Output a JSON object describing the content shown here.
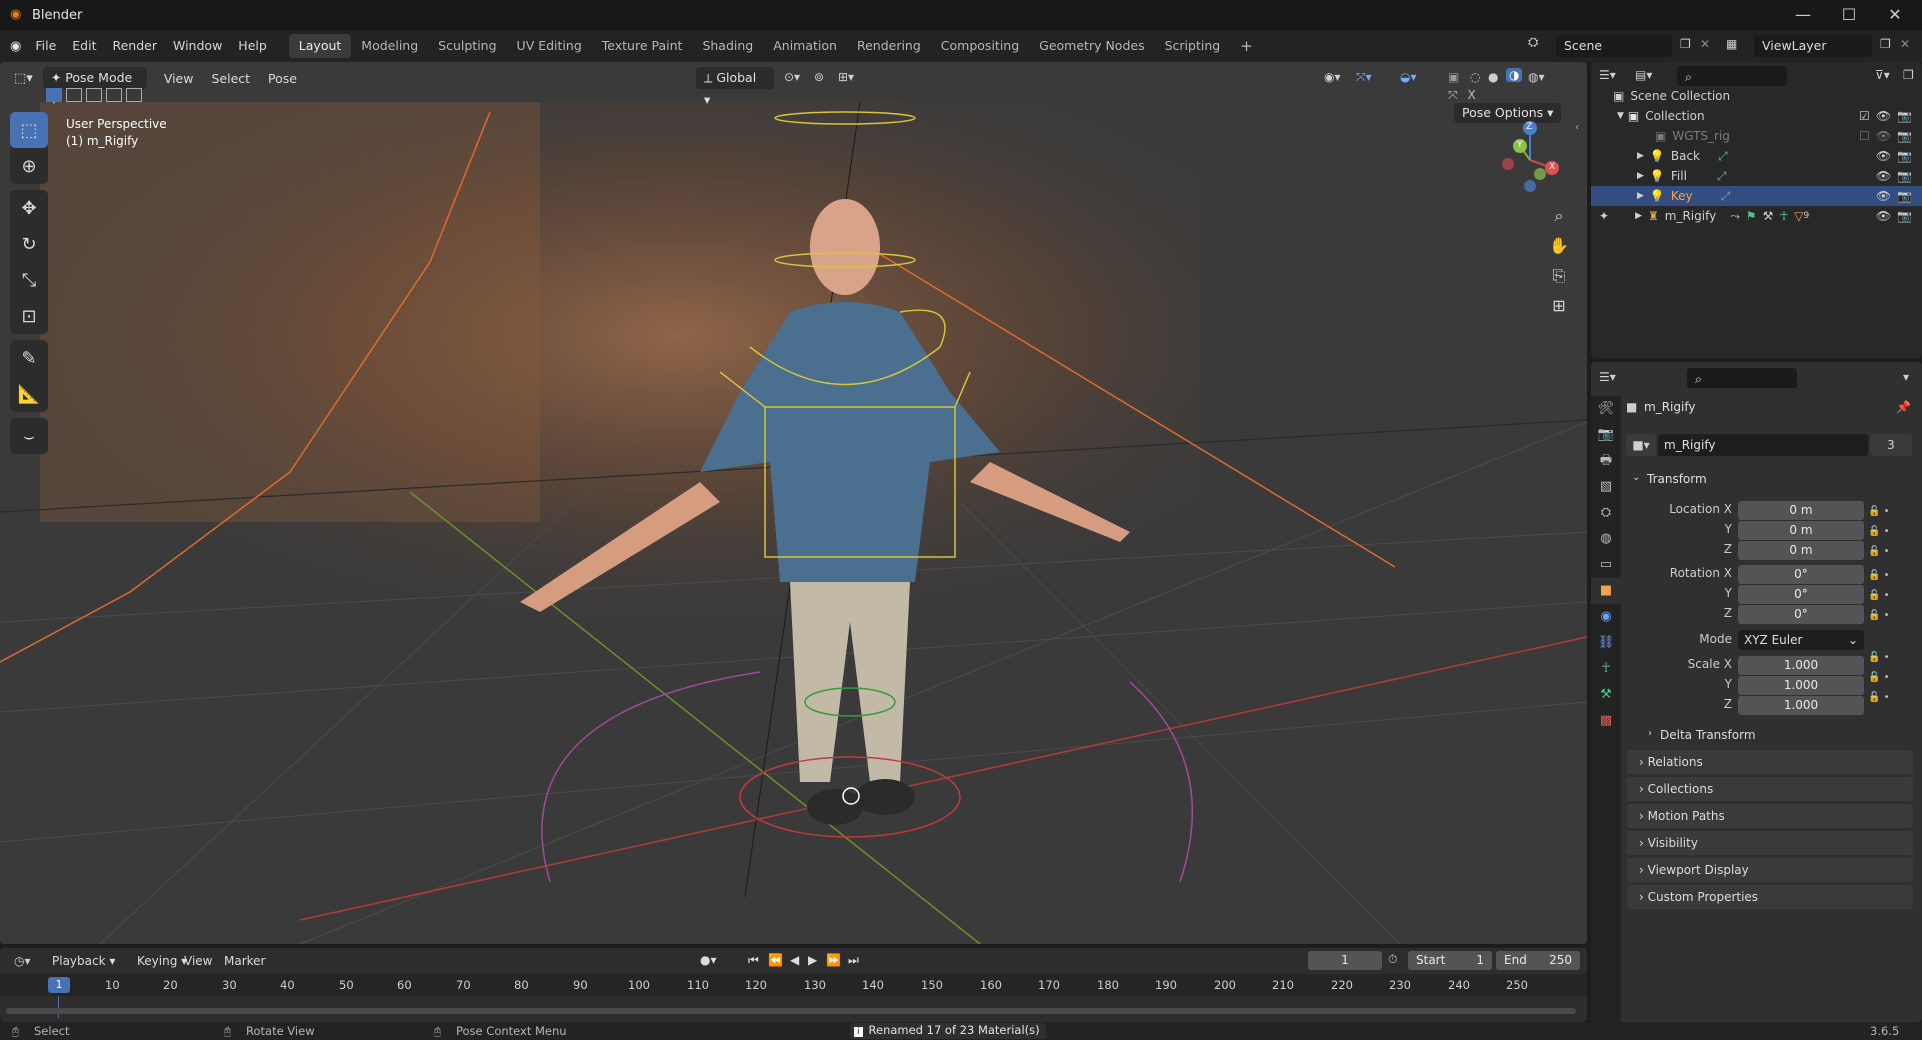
{
  "window": {
    "title": "Blender"
  },
  "menu": [
    "File",
    "Edit",
    "Render",
    "Window",
    "Help"
  ],
  "workspaces": [
    "Layout",
    "Modeling",
    "Sculpting",
    "UV Editing",
    "Texture Paint",
    "Shading",
    "Animation",
    "Rendering",
    "Compositing",
    "Geometry Nodes",
    "Scripting"
  ],
  "scene": {
    "name": "Scene",
    "view_layer": "ViewLayer"
  },
  "viewport": {
    "mode": "Pose Mode",
    "menus": [
      "View",
      "Select",
      "Pose"
    ],
    "orientation": "Global",
    "pose_options": "Pose Options",
    "info_line1": "User Perspective",
    "info_line2": "(1) m_Rigify",
    "gizmo": {
      "x": "X",
      "y": "Y",
      "z": "Z"
    }
  },
  "outliner": {
    "scene_collection": "Scene Collection",
    "collection": "Collection",
    "items": [
      "WGTS_rig",
      "Back",
      "Fill",
      "Key",
      "m_Rigify"
    ],
    "badge": "9"
  },
  "properties": {
    "object_name": "m_Rigify",
    "datablock_name": "m_Rigify",
    "users": "3",
    "transform_label": "Transform",
    "location_label": "Location X",
    "rotation_label": "Rotation X",
    "scale_label": "Scale X",
    "axis_y": "Y",
    "axis_z": "Z",
    "location": [
      "0 m",
      "0 m",
      "0 m"
    ],
    "rotation": [
      "0°",
      "0°",
      "0°"
    ],
    "mode_label": "Mode",
    "mode_value": "XYZ Euler",
    "scale": [
      "1.000",
      "1.000",
      "1.000"
    ],
    "delta_transform": "Delta Transform",
    "panels": [
      "Relations",
      "Collections",
      "Motion Paths",
      "Visibility",
      "Viewport Display",
      "Custom Properties"
    ]
  },
  "timeline": {
    "menus": [
      "Playback",
      "Keying",
      "View",
      "Marker"
    ],
    "current_frame": "1",
    "start_label": "Start",
    "start": "1",
    "end_label": "End",
    "end": "250",
    "ticks": [
      "1",
      "10",
      "20",
      "30",
      "40",
      "50",
      "60",
      "70",
      "80",
      "90",
      "100",
      "110",
      "120",
      "130",
      "140",
      "150",
      "160",
      "170",
      "180",
      "190",
      "200",
      "210",
      "220",
      "230",
      "240",
      "250"
    ]
  },
  "status": {
    "select": "Select",
    "rotate_view": "Rotate View",
    "pose_context_menu": "Pose Context Menu",
    "message": "Renamed 17 of 23 Material(s)",
    "version": "3.6.5"
  }
}
